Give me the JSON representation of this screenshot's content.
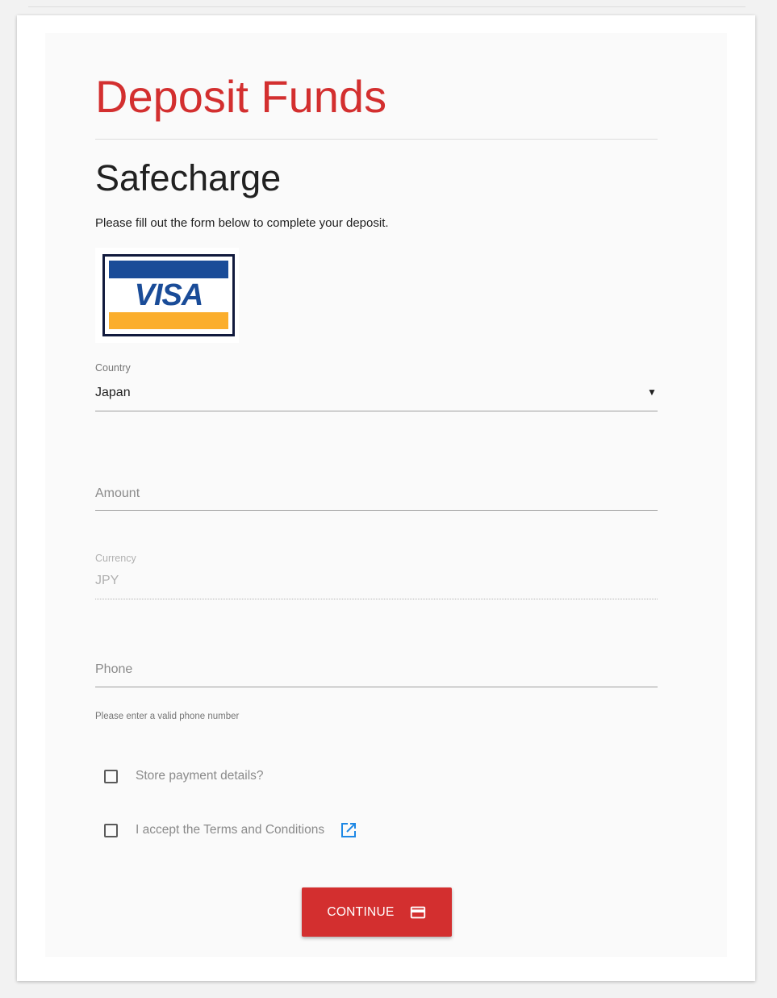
{
  "page": {
    "title": "Deposit Funds",
    "provider": "Safecharge",
    "intro": "Please fill out the form below to complete your deposit."
  },
  "payment_logo": {
    "text": "VISA",
    "colors": {
      "blue": "#1a4c98",
      "gold": "#fbae2c",
      "border": "#111a3d"
    }
  },
  "form": {
    "country": {
      "label": "Country",
      "value": "Japan"
    },
    "amount": {
      "placeholder": "Amount",
      "value": ""
    },
    "currency": {
      "label": "Currency",
      "value": "JPY"
    },
    "phone": {
      "placeholder": "Phone",
      "value": "",
      "hint": "Please enter a valid phone number"
    },
    "store_payment": {
      "label": "Store payment details?",
      "checked": false
    },
    "terms": {
      "label": "I accept the Terms and Conditions",
      "checked": false,
      "icon": "open-in-new-icon"
    }
  },
  "actions": {
    "continue_label": "CONTINUE",
    "continue_icon": "credit-card-icon"
  },
  "colors": {
    "accent": "#d32f2f",
    "link_icon": "#1e88e5"
  }
}
